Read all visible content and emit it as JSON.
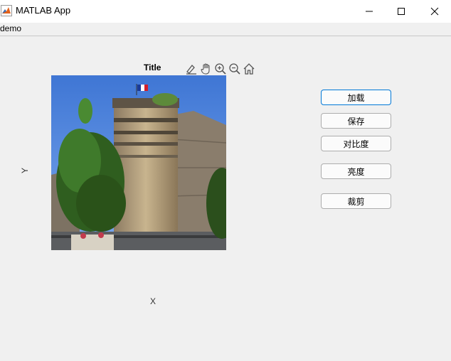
{
  "window": {
    "title": "MATLAB App"
  },
  "menu": {
    "items": [
      {
        "label": "demo"
      }
    ]
  },
  "axes": {
    "title": "Title",
    "xlabel": "X",
    "ylabel": "Y",
    "toolbar_icons": [
      "brush-icon",
      "pan-icon",
      "zoom-in-icon",
      "zoom-out-icon",
      "home-icon"
    ]
  },
  "buttons": {
    "load": "加载",
    "save": "保存",
    "contrast": "对比度",
    "brightness": "亮度",
    "crop": "裁剪"
  }
}
